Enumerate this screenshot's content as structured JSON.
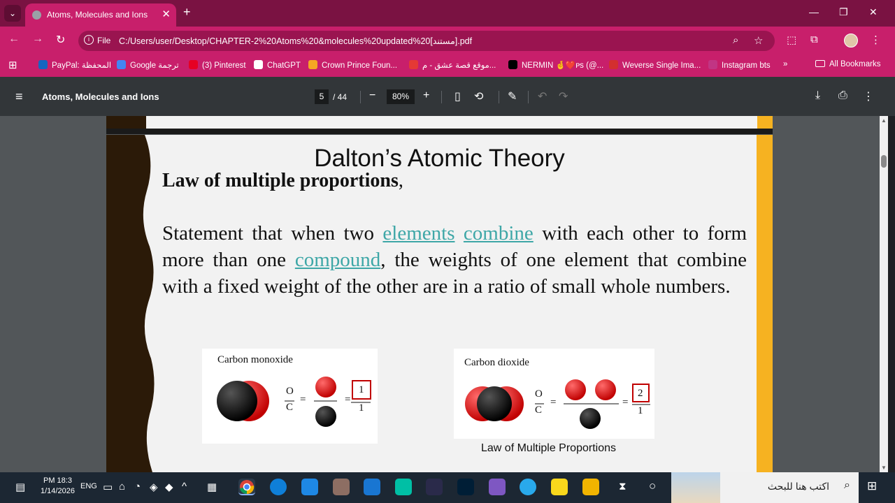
{
  "browser": {
    "tab_title": "Atoms, Molecules and Ions",
    "file_label": "File",
    "url": "C:/Users/user/Desktop/CHAPTER-2%20Atoms%20&molecules%20updated%20[مستند].pdf",
    "bookmarks": [
      {
        "label": "PayPal: المحفظة",
        "color": "#1565c0"
      },
      {
        "label": "Google ترجمة",
        "color": "#4285f4"
      },
      {
        "label": "(3) Pinterest",
        "color": "#e60023"
      },
      {
        "label": "ChatGPT",
        "color": "#ffffff"
      },
      {
        "label": "Crown Prince Foun...",
        "color": "#f5a623"
      },
      {
        "label": "موقع قصة عشق - م...",
        "color": "#e53935"
      },
      {
        "label": "NERMIN 🤞❤️ᴘs (@...",
        "color": "#000000"
      },
      {
        "label": "Weverse Single Ima...",
        "color": "#d32f2f"
      },
      {
        "label": "Instagram bts",
        "color": "#c13584"
      }
    ],
    "all_bookmarks": "All Bookmarks",
    "more_bookmarks": "»"
  },
  "pdf": {
    "title": "Atoms, Molecules and Ions",
    "page_current": "5",
    "page_total": "/ 44",
    "zoom": "80%"
  },
  "slide": {
    "title": "Dalton’s Atomic Theory",
    "subtitle": "Law of multiple proportions",
    "subtitle_comma": ",",
    "statement": {
      "part1": "Statement that when two ",
      "link1": "elements",
      "sp": " ",
      "link2": "combine",
      "part2": " with each other to form more than one ",
      "link3": "compound",
      "part3": ", the weights of one element that combine with a fixed weight of the other are in a ratio of small whole numbers."
    },
    "figure1": {
      "caption": "Carbon monoxide",
      "O": "O",
      "C": "C",
      "eq": "=",
      "num": "1",
      "den": "1"
    },
    "figure2": {
      "caption": "Carbon dioxide",
      "O": "O",
      "C": "C",
      "eq": "=",
      "num": "2",
      "den": "1"
    },
    "figure_label": "Law of Multiple Proportions"
  },
  "taskbar": {
    "time": "PM 18:3",
    "date": "1/14/2026",
    "lang": "ENG",
    "search_placeholder": "اكتب هنا للبحث"
  }
}
